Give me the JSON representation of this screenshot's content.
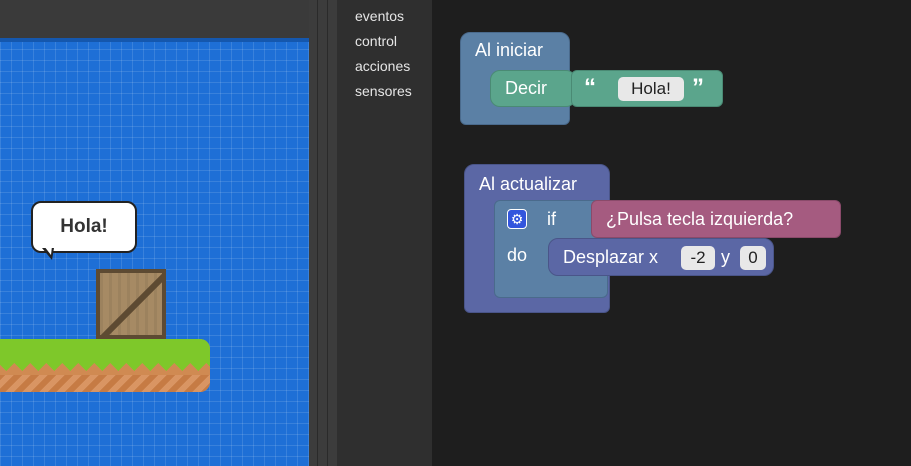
{
  "stage": {
    "speech_bubble_text": "Hola!"
  },
  "toolbox": {
    "categories": [
      "eventos",
      "control",
      "acciones",
      "sensores"
    ]
  },
  "workspace": {
    "start_block": {
      "title": "Al iniciar",
      "say_label": "Decir",
      "quote_open": "“",
      "quote_close": "”",
      "say_value": "Hola!"
    },
    "update_block": {
      "title": "Al actualizar",
      "if_label": "if",
      "do_label": "do",
      "condition_label": "¿Pulsa tecla izquierda?",
      "move_label": "Desplazar x",
      "x_value": "-2",
      "y_label": "y",
      "y_value": "0"
    }
  },
  "colors": {
    "start_block": "#5b80a5",
    "say_block": "#5ba58c",
    "update_block": "#5b67a5",
    "sensor_block": "#a55b80"
  },
  "icons": [
    "gear-icon"
  ]
}
